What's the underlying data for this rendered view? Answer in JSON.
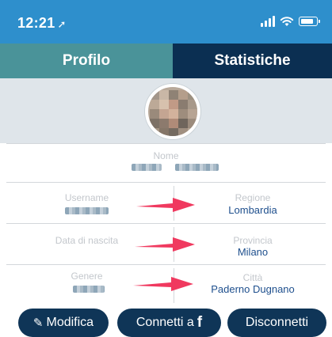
{
  "status_bar": {
    "time": "12:21",
    "location_glyph": "➚"
  },
  "tabs": [
    {
      "label": "Profilo",
      "active": true
    },
    {
      "label": "Statistiche",
      "active": false
    }
  ],
  "profile": {
    "nome_label": "Nome",
    "username_label": "Username",
    "data_nascita_label": "Data di nascita",
    "genere_label": "Genere",
    "regione_label": "Regione",
    "regione_value": "Lombardia",
    "provincia_label": "Provincia",
    "provincia_value": "Milano",
    "citta_label": "Città",
    "citta_value": "Paderno Dugnano"
  },
  "buttons": {
    "modifica": "Modifica",
    "modifica_icon": "✎",
    "connetti": "Connetti a",
    "connetti_icon": "f",
    "disconnetti": "Disconnetti"
  },
  "icons": [
    "location-arrow-icon",
    "signal-icon",
    "wifi-icon",
    "battery-icon",
    "pencil-icon",
    "facebook-icon"
  ],
  "colors": {
    "status_bar": "#2e8fcc",
    "tab_active": "#4a9399",
    "tab_inactive": "#0b2f52",
    "button": "#0f3557",
    "value_text": "#1e4f8d",
    "annotation_arrow": "#f0395f"
  }
}
